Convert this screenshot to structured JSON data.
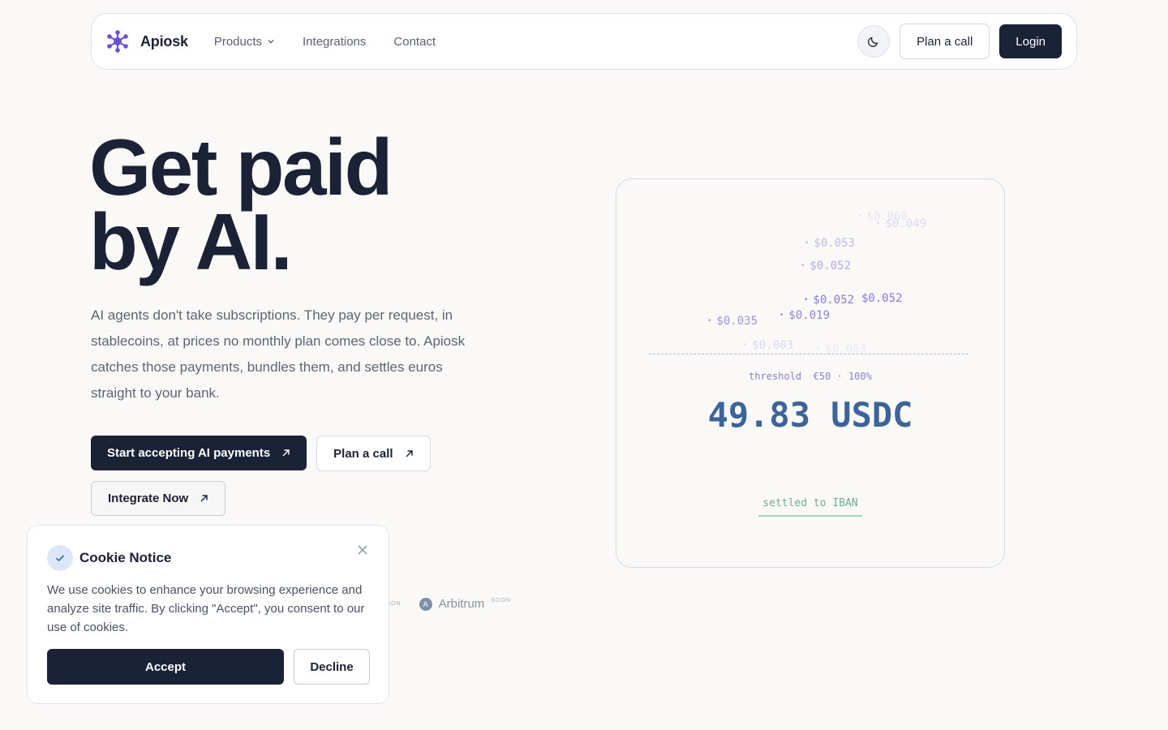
{
  "nav": {
    "brand": "Apiosk",
    "links": [
      {
        "label": "Products",
        "has_dropdown": true
      },
      {
        "label": "Integrations"
      },
      {
        "label": "Contact"
      }
    ],
    "plan_call": "Plan a call",
    "login": "Login",
    "theme_icon": "moon-icon"
  },
  "hero": {
    "title_line1": "Get paid",
    "title_line2": "by AI.",
    "description": "AI agents don't take subscriptions. They pay per request, in stablecoins, at prices no monthly plan comes close to. Apiosk catches those payments, bundles them, and settles euros straight to your bank.",
    "cta_primary": "Start accepting AI payments",
    "cta_secondary": "Plan a call",
    "cta_tertiary": "Integrate Now"
  },
  "chains": {
    "soon_label_1": "SOON",
    "arbitrum": "Arbitrum",
    "soon_label_2": "SOON"
  },
  "viz": {
    "transactions": [
      "$0.060",
      "$0.049",
      "$0.053",
      "$0.052",
      "$0.052",
      "$0.052",
      "$0.035",
      "$0.019",
      "$0.003",
      "$0.083"
    ],
    "threshold_label": "threshold",
    "threshold_value": "€50 · 100%",
    "amount": "49.83 USDC",
    "settled": "settled to IBAN"
  },
  "cookie": {
    "title": "Cookie Notice",
    "text": "We use cookies to enhance your browsing experience and analyze site traffic. By clicking \"Accept\", you consent to our use of cookies.",
    "accept": "Accept",
    "decline": "Decline"
  },
  "colors": {
    "brand_dark": "#1b2236",
    "accent_purple": "#6b4fd8",
    "amount_blue": "#3d6499",
    "settled_green": "#6fae8c"
  }
}
